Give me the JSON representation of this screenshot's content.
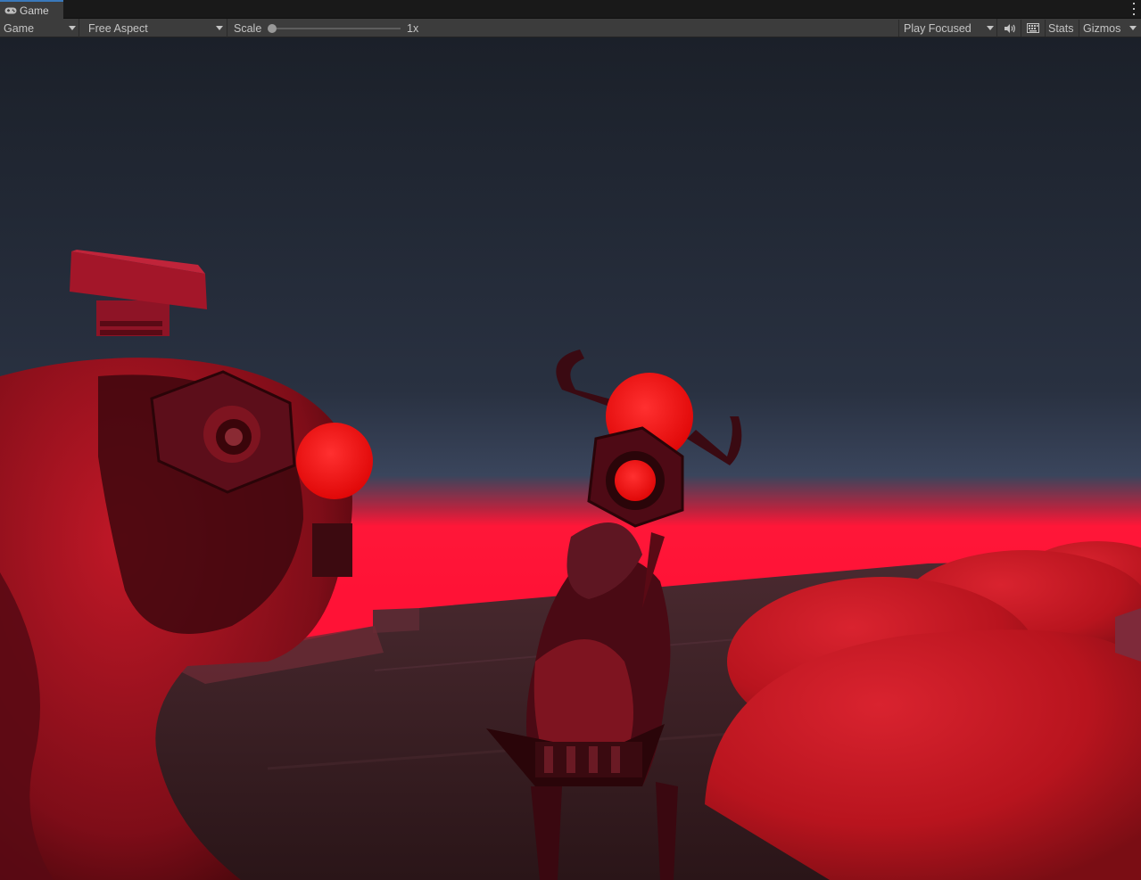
{
  "tab": {
    "label": "Game",
    "icon": "gamepad-icon"
  },
  "toolbar": {
    "display_select": "Game",
    "aspect_select": "Free Aspect",
    "scale_label": "Scale",
    "scale_value_label": "1x",
    "scale_value": 1,
    "play_mode_select": "Play Focused",
    "audio_icon": "speaker-icon",
    "shortcuts_icon": "keyboard-icon",
    "stats_label": "Stats",
    "gizmos_label": "Gizmos"
  },
  "scene": {
    "description_colors": {
      "sky_top": "#1b212a",
      "horizon_glow": "#ff1236",
      "ground": "#3a1e24",
      "eye_glow": "#ff1010"
    }
  }
}
